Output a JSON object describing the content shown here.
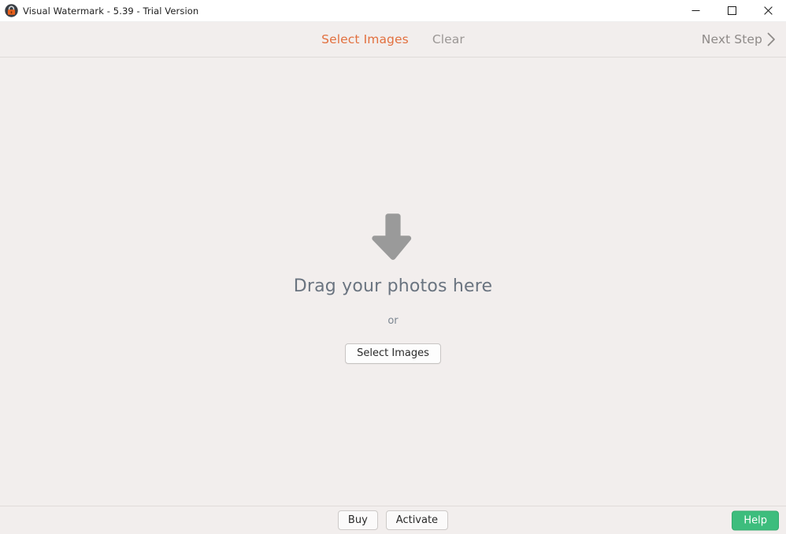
{
  "window": {
    "title": "Visual Watermark - 5.39 - Trial Version",
    "icon": "padlock-icon",
    "controls": {
      "minimize": "minimize-icon",
      "maximize": "maximize-icon",
      "close": "close-icon"
    }
  },
  "toolbar": {
    "select_images_label": "Select Images",
    "clear_label": "Clear",
    "next_step_label": "Next Step",
    "next_step_icon": "chevron-right-icon",
    "accent_color": "#e2703f",
    "muted_color": "#9b9795"
  },
  "dropzone": {
    "arrow_icon": "arrow-down-icon",
    "title": "Drag your photos here",
    "or_label": "or",
    "select_images_button": "Select Images"
  },
  "bottombar": {
    "buy_label": "Buy",
    "activate_label": "Activate",
    "help_label": "Help",
    "help_color": "#3dbd7d"
  }
}
